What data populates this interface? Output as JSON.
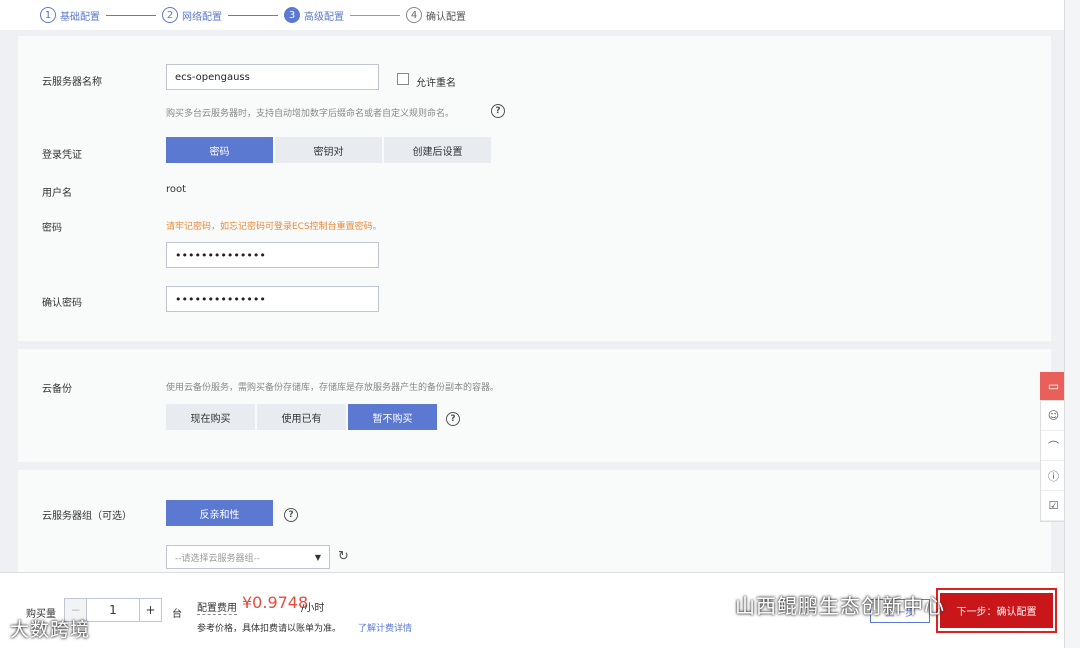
{
  "steps": [
    {
      "num": "1",
      "label": "基础配置"
    },
    {
      "num": "2",
      "label": "网络配置"
    },
    {
      "num": "3",
      "label": "高级配置"
    },
    {
      "num": "4",
      "label": "确认配置"
    }
  ],
  "server": {
    "name_label": "云服务器名称",
    "name_value": "ecs-opengauss",
    "allow_dup_label": "允许重名",
    "name_hint": "购买多台云服务器时，支持自动增加数字后缀命名或者自定义规则命名。"
  },
  "login": {
    "label": "登录凭证",
    "options": [
      "密码",
      "密钥对",
      "创建后设置"
    ],
    "username_label": "用户名",
    "username_value": "root",
    "password_label": "密码",
    "password_warn": "请牢记密码，如忘记密码可登录ECS控制台重置密码。",
    "password_value": "••••••••••••••",
    "confirm_label": "确认密码",
    "confirm_value": "••••••••••••••"
  },
  "backup": {
    "label": "云备份",
    "hint": "使用云备份服务，需购买备份存储库，存储库是存放服务器产生的备份副本的容器。",
    "options": [
      "现在购买",
      "使用已有",
      "暂不购买"
    ]
  },
  "group": {
    "label": "云服务器组（可选）",
    "button": "反亲和性",
    "select_placeholder": "--请选择云服务器组--"
  },
  "float_icons": [
    "chat-icon",
    "smile-icon",
    "headset-icon",
    "question-icon",
    "checklist-icon"
  ],
  "footer": {
    "qty_label": "购买量",
    "qty_value": "1",
    "qty_unit": "台",
    "fee_label": "配置费用",
    "price": "¥0.9748",
    "price_unit": "/小时",
    "ref_text": "参考价格，具体扣费请以账单为准。",
    "ref_link": "了解计费详情",
    "prev_button": "上一步",
    "next_button": "下一步：确认配置"
  },
  "watermarks": {
    "left": "大数跨境",
    "right": "山西鲲鹏生态创新中心"
  },
  "colors": {
    "primary": "#5b79d0",
    "price": "#e84c3d",
    "warn": "#e8883a",
    "next": "#c9161a"
  }
}
